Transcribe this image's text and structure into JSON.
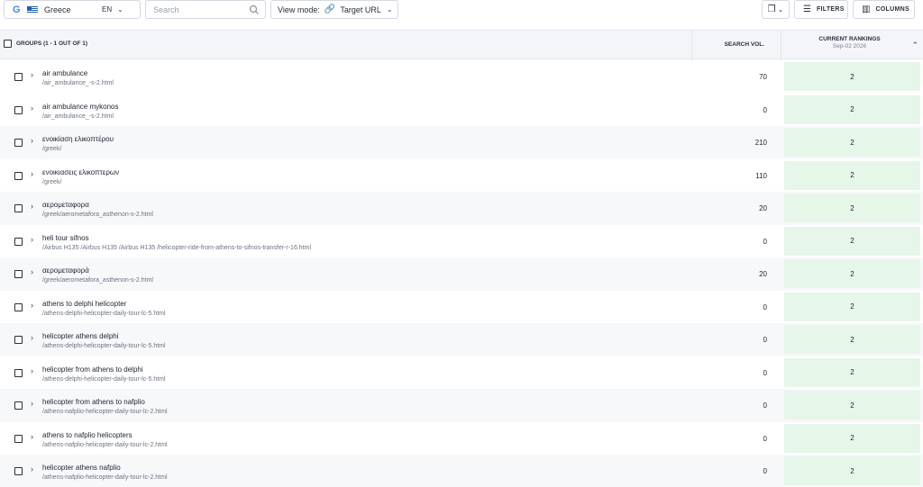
{
  "toolbar": {
    "location": {
      "engine_icon": "google-icon",
      "engine_glyph": "G",
      "country": "Greece",
      "language": "EN"
    },
    "search": {
      "placeholder": "Search"
    },
    "view_mode": {
      "label": "View mode:",
      "value": "Target URL"
    },
    "filters_label": "FILTERS",
    "columns_label": "COLUMNS"
  },
  "table": {
    "groups_header": "GROUPS (1 - 1 OUT OF 1)",
    "search_vol_header": "SEARCH VOL.",
    "rankings_header": "CURRENT RANKINGS",
    "rankings_date": "Sep-02 2026",
    "rows": [
      {
        "keyword": "air ambulance",
        "url": "/air_ambulance_-s-2.html",
        "vol": "70",
        "rank": "2"
      },
      {
        "keyword": "air ambulance mykonos",
        "url": "/air_ambulance_-s-2.html",
        "vol": "0",
        "rank": "2"
      },
      {
        "keyword": "ενοικίαση ελικοπτέρου",
        "url": "/greek/",
        "vol": "210",
        "rank": "2"
      },
      {
        "keyword": "ενοικιασεις ελικοπτερων",
        "url": "/greek/",
        "vol": "110",
        "rank": "2"
      },
      {
        "keyword": "αερομεταφορα",
        "url": "/greek/aerometafora_asthenon-s-2.html",
        "vol": "20",
        "rank": "2"
      },
      {
        "keyword": "heli tour sifnos",
        "url": "/Airbus H135 /Airbus H135 /Airbus H135 /helicopter-ride-from-athens-to-sifnos-transfer-r-16.html",
        "vol": "0",
        "rank": "2"
      },
      {
        "keyword": "αερομεταφορά",
        "url": "/greek/aerometafora_asthenon-s-2.html",
        "vol": "20",
        "rank": "2"
      },
      {
        "keyword": "athens to delphi helicopter",
        "url": "/athens-delphi-helicopter-daily-tour-lc-5.html",
        "vol": "0",
        "rank": "2"
      },
      {
        "keyword": "helicopter athens delphi",
        "url": "/athens-delphi-helicopter-daily-tour-lc-5.html",
        "vol": "0",
        "rank": "2"
      },
      {
        "keyword": "helicopter from athens to delphi",
        "url": "/athens-delphi-helicopter-daily-tour-lc-5.html",
        "vol": "0",
        "rank": "2"
      },
      {
        "keyword": "helicopter from athens to nafplio",
        "url": "/athens-nafplio-helicopter-daily-tour-lc-2.html",
        "vol": "0",
        "rank": "2"
      },
      {
        "keyword": "athens to nafplio helicopters",
        "url": "/athens-nafplio-helicopter-daily-tour-lc-2.html",
        "vol": "0",
        "rank": "2"
      },
      {
        "keyword": "helicopter athens nafplio",
        "url": "/athens-nafplio-helicopter-daily-tour-lc-2.html",
        "vol": "0",
        "rank": "2"
      }
    ]
  },
  "colors": {
    "rank_cell": "#e6f6e9",
    "header_bg": "#f3f5f9",
    "alt_row": "#f7f8fa"
  }
}
